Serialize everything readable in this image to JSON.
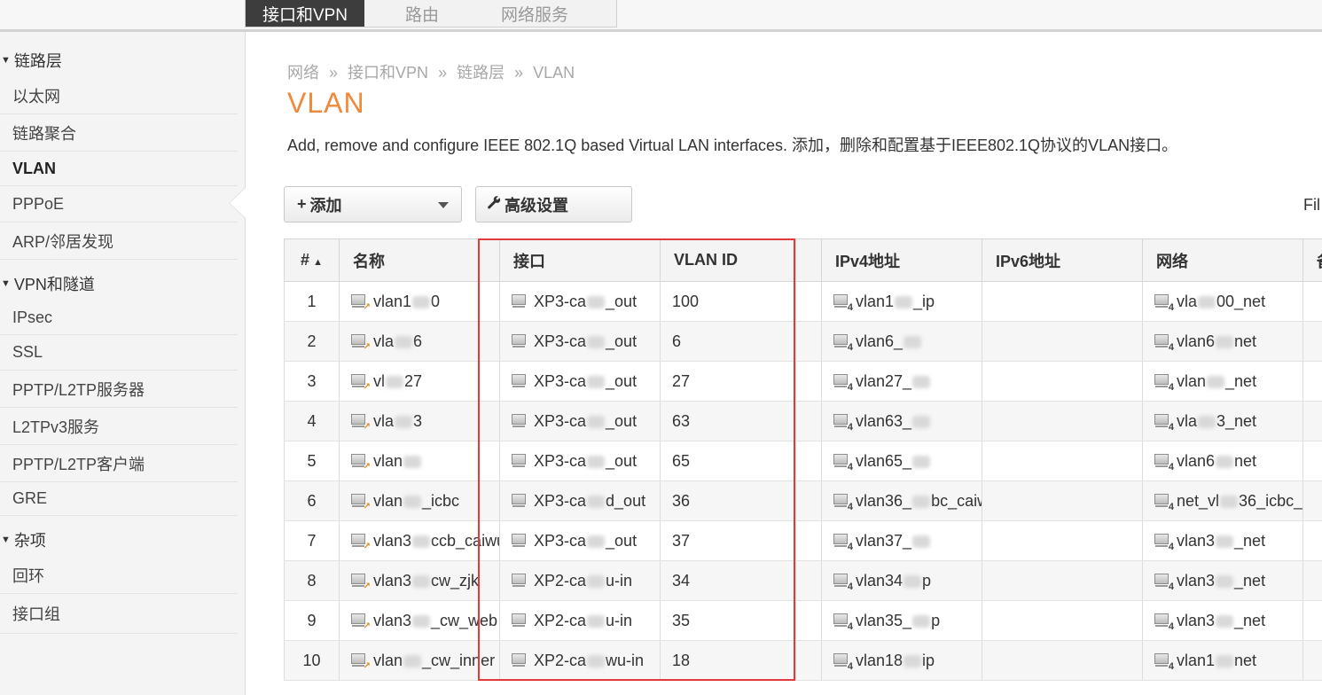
{
  "top_tabs": [
    "接口和VPN",
    "路由",
    "网络服务"
  ],
  "sidebar": {
    "groups": [
      {
        "label": "链路层",
        "items": [
          "以太网",
          "链路聚合",
          "VLAN",
          "PPPoE",
          "ARP/邻居发现"
        ]
      },
      {
        "label": "VPN和隧道",
        "items": [
          "IPsec",
          "SSL",
          "PPTP/L2TP服务器",
          "L2TPv3服务",
          "PPTP/L2TP客户端",
          "GRE"
        ]
      },
      {
        "label": "杂项",
        "items": [
          "回环",
          "接口组"
        ]
      }
    ],
    "active_item": "VLAN"
  },
  "breadcrumb": [
    "网络",
    "»",
    "接口和VPN",
    "»",
    "链路层",
    "»",
    "VLAN"
  ],
  "page_title": "VLAN",
  "description": "Add, remove and configure IEEE 802.1Q based Virtual LAN interfaces. 添加，删除和配置基于IEEE802.1Q协议的VLAN接口。",
  "toolbar": {
    "add_icon": "+",
    "add_label": "添加",
    "advanced_label": "高级设置",
    "advanced_icon": "wrench-icon",
    "filter_label": "Fil"
  },
  "table": {
    "headers": {
      "num": "#",
      "name": "名称",
      "interface": "接口",
      "vlan_id": "VLAN ID",
      "ipv4": "IPv4地址",
      "ipv6": "IPv6地址",
      "network": "网络",
      "extra": "备"
    },
    "rows": [
      {
        "num": "1",
        "name_a": "vlan1",
        "name_b": "0",
        "iface_a": "XP3-ca",
        "iface_b": "_out",
        "vlan_id": "100",
        "ipv4_a": "vlan1",
        "ipv4_b": "_ip",
        "ipv6": "",
        "net_a": "vla",
        "net_b": "00_net"
      },
      {
        "num": "2",
        "name_a": "vla",
        "name_b": "6",
        "iface_a": "XP3-ca",
        "iface_b": "_out",
        "vlan_id": "6",
        "ipv4_a": "vlan6_",
        "ipv4_b": "",
        "ipv6": "",
        "net_a": "vlan6",
        "net_b": "net"
      },
      {
        "num": "3",
        "name_a": "vl",
        "name_b": "27",
        "iface_a": "XP3-ca",
        "iface_b": "_out",
        "vlan_id": "27",
        "ipv4_a": "vlan27_",
        "ipv4_b": "",
        "ipv6": "",
        "net_a": "vlan",
        "net_b": "_net"
      },
      {
        "num": "4",
        "name_a": "vla",
        "name_b": "3",
        "iface_a": "XP3-ca",
        "iface_b": "_out",
        "vlan_id": "63",
        "ipv4_a": "vlan63_",
        "ipv4_b": "",
        "ipv6": "",
        "net_a": "vla",
        "net_b": "3_net"
      },
      {
        "num": "5",
        "name_a": "vlan",
        "name_b": "",
        "iface_a": "XP3-ca",
        "iface_b": "_out",
        "vlan_id": "65",
        "ipv4_a": "vlan65_",
        "ipv4_b": "",
        "ipv6": "",
        "net_a": "vlan6",
        "net_b": "net"
      },
      {
        "num": "6",
        "name_a": "vlan",
        "name_b": "_icbc",
        "iface_a": "XP3-ca",
        "iface_b": "d_out",
        "vlan_id": "36",
        "ipv4_a": "vlan36_",
        "ipv4_b": "bc_caiwu",
        "ipv6": "",
        "net_a": "net_vl",
        "net_b": "36_icbc_c"
      },
      {
        "num": "7",
        "name_a": "vlan3",
        "name_b": "ccb_caiwu",
        "iface_a": "XP3-ca",
        "iface_b": "_out",
        "vlan_id": "37",
        "ipv4_a": "vlan37_",
        "ipv4_b": "",
        "ipv6": "",
        "net_a": "vlan3",
        "net_b": "_net"
      },
      {
        "num": "8",
        "name_a": "vlan3",
        "name_b": "cw_zjk",
        "iface_a": "XP2-ca",
        "iface_b": "u-in",
        "vlan_id": "34",
        "ipv4_a": "vlan34",
        "ipv4_b": "p",
        "ipv6": "",
        "net_a": "vlan3",
        "net_b": "_net"
      },
      {
        "num": "9",
        "name_a": "vlan3",
        "name_b": "_cw_web",
        "iface_a": "XP2-ca",
        "iface_b": "u-in",
        "vlan_id": "35",
        "ipv4_a": "vlan35_",
        "ipv4_b": "p",
        "ipv6": "",
        "net_a": "vlan3",
        "net_b": "_net"
      },
      {
        "num": "10",
        "name_a": "vlan",
        "name_b": "_cw_inner",
        "iface_a": "XP2-ca",
        "iface_b": "wu-in",
        "vlan_id": "18",
        "ipv4_a": "vlan18",
        "ipv4_b": "ip",
        "ipv6": "",
        "net_a": "vlan1",
        "net_b": "net"
      }
    ]
  },
  "colors": {
    "title": "#f0893b",
    "highlight_box": "#e23a3a",
    "active_tab_bg": "#3d3d3d"
  }
}
